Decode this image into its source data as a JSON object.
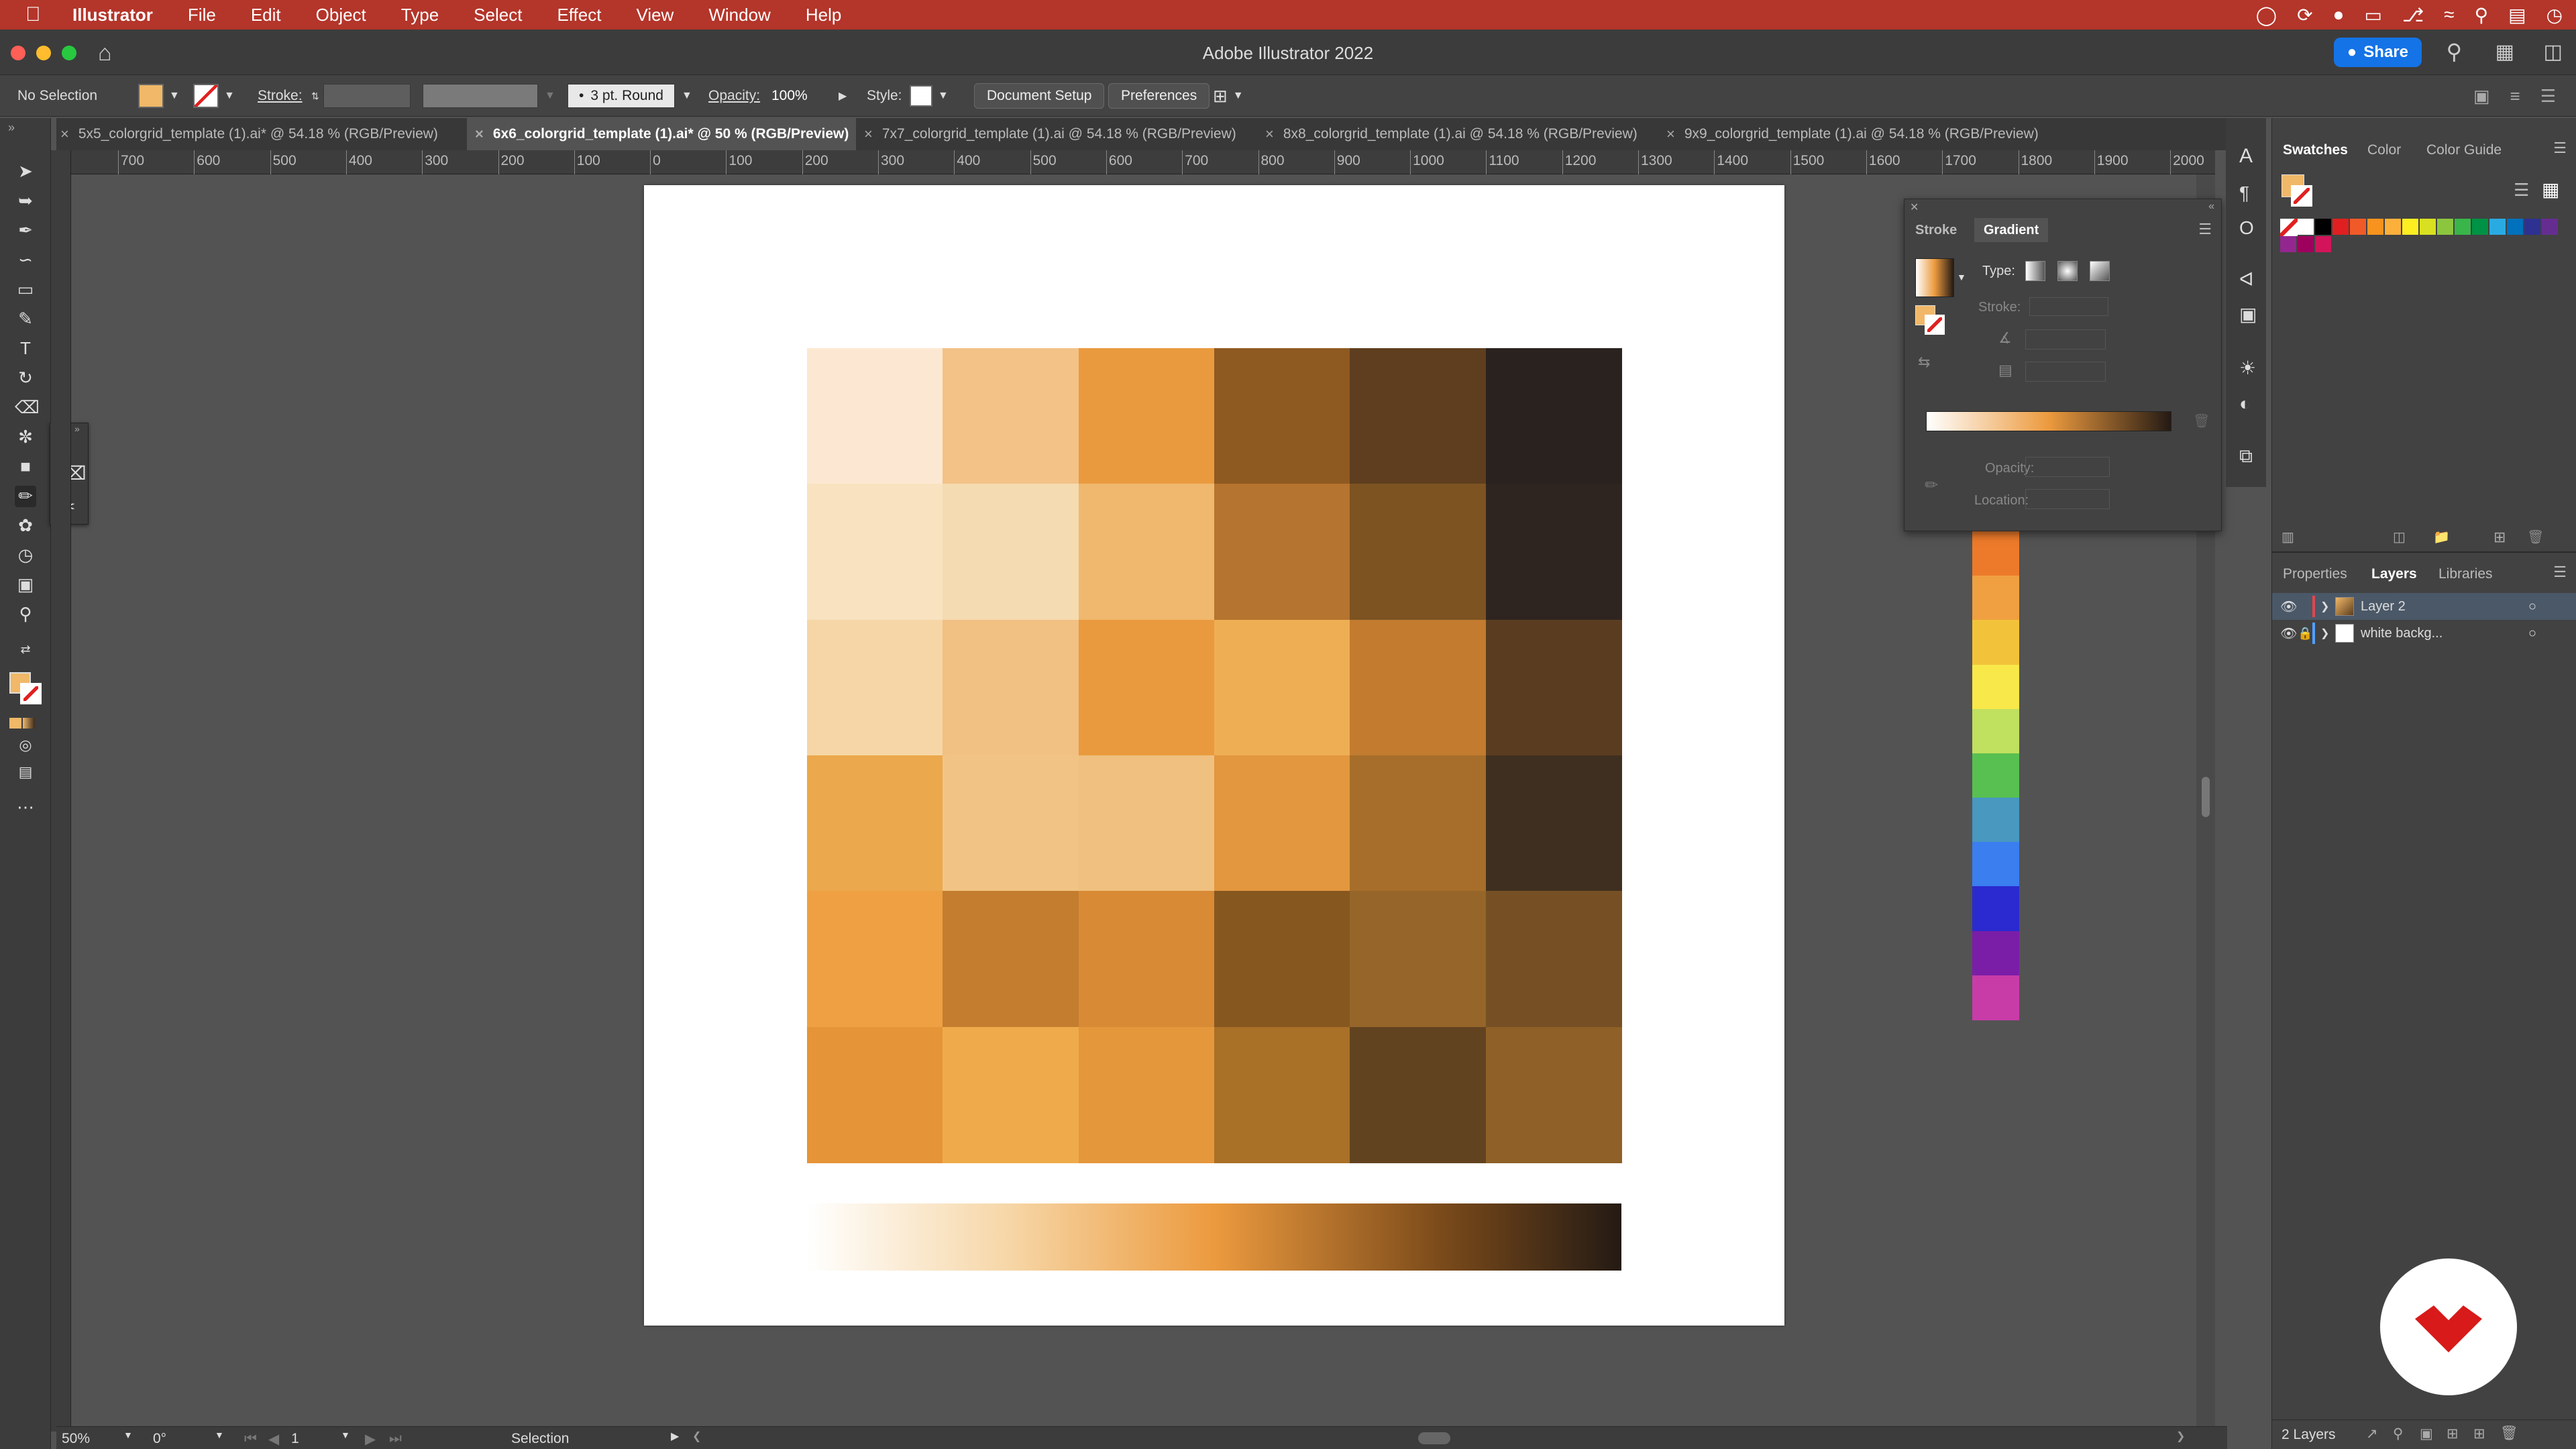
{
  "menubar": {
    "app": "Illustrator",
    "menus": [
      "File",
      "Edit",
      "Object",
      "Type",
      "Select",
      "Effect",
      "View",
      "Window",
      "Help"
    ]
  },
  "titlebar": {
    "title": "Adobe Illustrator 2022",
    "share_label": "Share"
  },
  "controlbar": {
    "selection": "No Selection",
    "stroke_label": "Stroke:",
    "brush": "3 pt. Round",
    "opacity_label": "Opacity:",
    "opacity_value": "100%",
    "style_label": "Style:",
    "document_setup": "Document Setup",
    "preferences": "Preferences",
    "fill_color": "#f0b868"
  },
  "tabs": [
    {
      "label": "5x5_colorgrid_template (1).ai* @ 54.18 % (RGB/Preview)",
      "active": false
    },
    {
      "label": "6x6_colorgrid_template (1).ai* @ 50 % (RGB/Preview)",
      "active": true
    },
    {
      "label": "7x7_colorgrid_template (1).ai @ 54.18 % (RGB/Preview)",
      "active": false
    },
    {
      "label": "8x8_colorgrid_template (1).ai @ 54.18 % (RGB/Preview)",
      "active": false
    },
    {
      "label": "9x9_colorgrid_template (1).ai @ 54.18 % (RGB/Preview)",
      "active": false
    }
  ],
  "ruler": {
    "h_ticks": [
      "700",
      "600",
      "500",
      "400",
      "300",
      "200",
      "100",
      "0",
      "100",
      "200",
      "300",
      "400",
      "500",
      "600",
      "700",
      "800",
      "900",
      "1000",
      "1100",
      "1200",
      "1300",
      "1400",
      "1500",
      "1600",
      "1700",
      "1800",
      "1900",
      "2000"
    ]
  },
  "colorgrid": {
    "rows": [
      [
        "#fce8d2",
        "#f2c287",
        "#ea9a3e",
        "#8f5a21",
        "#5e3e1e",
        "#2a221f"
      ],
      [
        "#f8e2c0",
        "#f5dbb1",
        "#efb86e",
        "#b5742f",
        "#7d5322",
        "#2f2520"
      ],
      [
        "#f6d6a6",
        "#f1c083",
        "#ea9a3e",
        "#eeae54",
        "#c27b2f",
        "#5a3d20"
      ],
      [
        "#eba84c",
        "#f1c485",
        "#efc07f",
        "#e3973f",
        "#a66e2a",
        "#3f2f20"
      ],
      [
        "#eea043",
        "#c47d2f",
        "#d98a35",
        "#865820",
        "#96652a",
        "#765024"
      ],
      [
        "#e59437",
        "#efab4b",
        "#e5973c",
        "#a97027",
        "#624320",
        "#8f6027"
      ]
    ]
  },
  "gradient_panel": {
    "tab_stroke": "Stroke",
    "tab_gradient": "Gradient",
    "type_label": "Type:",
    "stroke_label": "Stroke:",
    "opacity_label": "Opacity:",
    "location_label": "Location:"
  },
  "spectrum": [
    "#ec7a2a",
    "#f0a040",
    "#f2c33a",
    "#f8e84a",
    "#c0e060",
    "#58c050",
    "#4898c0",
    "#3a7ef0",
    "#2a2ad0",
    "#7a1ea8",
    "#c83ca8"
  ],
  "swatches_panel": {
    "tabs": [
      "Swatches",
      "Color",
      "Color Guide"
    ],
    "colors": [
      "#ffffff",
      "#000000",
      "#e02020",
      "#f05a28",
      "#f7931e",
      "#fbb03b",
      "#fcee21",
      "#d9e021",
      "#8cc63f",
      "#39b54a",
      "#009245",
      "#29abe2",
      "#0071bc",
      "#2e3192",
      "#662d91",
      "#93278f",
      "#9e005d",
      "#d4145a"
    ]
  },
  "layers_panel": {
    "tabs": [
      "Properties",
      "Layers",
      "Libraries"
    ],
    "layers": [
      {
        "name": "Layer 2",
        "color": "#e0474c"
      },
      {
        "name": "white backg...",
        "color": "#4fa0ff"
      }
    ],
    "count": "2 Layers"
  },
  "statusbar": {
    "zoom": "50%",
    "rotation": "0°",
    "artboard": "1",
    "tool": "Selection"
  }
}
